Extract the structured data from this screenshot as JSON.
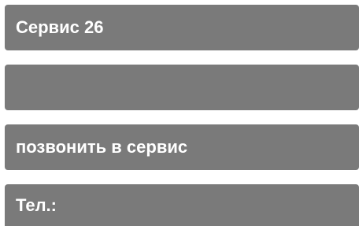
{
  "service": {
    "title": "Сервис 26",
    "empty_field": "",
    "call_label": "позвонить в сервис",
    "phone_label": "Тел.:"
  },
  "colors": {
    "bar_background": "#7a7a7a",
    "text": "#ffffff"
  }
}
